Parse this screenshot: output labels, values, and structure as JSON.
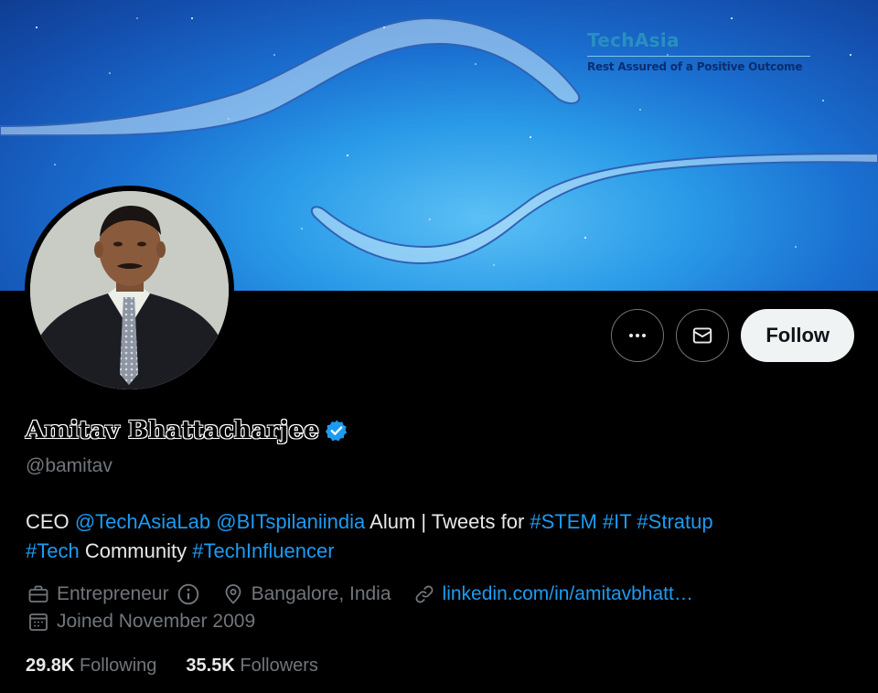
{
  "banner": {
    "brand_name": "TechAsia",
    "brand_tagline": "Rest Assured of a Positive Outcome"
  },
  "actions": {
    "more_icon": "more-horizontal-icon",
    "message_icon": "envelope-icon",
    "follow_label": "Follow"
  },
  "profile": {
    "name": "Amitav Bhattacharjee",
    "verified_icon": "verified-badge-icon",
    "handle": "@bamitav",
    "bio": {
      "ceo": "CEO",
      "mention1": "@TechAsiaLab",
      "mention2": "@BITspilaniindia",
      "alum": "Alum | Tweets for",
      "tag_stem": "#STEM",
      "tag_it": "#IT",
      "tag_stratup": "#Stratup",
      "tag_tech": "#Tech",
      "community": "Community",
      "tag_influencer": "#TechInfluencer"
    },
    "profession": "Entrepreneur",
    "location": "Bangalore, India",
    "website": "linkedin.com/in/amitavbhatt…",
    "joined": "Joined November 2009",
    "following_count": "29.8K",
    "following_label": "Following",
    "followers_count": "35.5K",
    "followers_label": "Followers"
  },
  "colors": {
    "link": "#1d9bf0",
    "secondary_text": "#71767b",
    "follow_bg": "#eff3f4",
    "verified": "#1d9bf0"
  }
}
